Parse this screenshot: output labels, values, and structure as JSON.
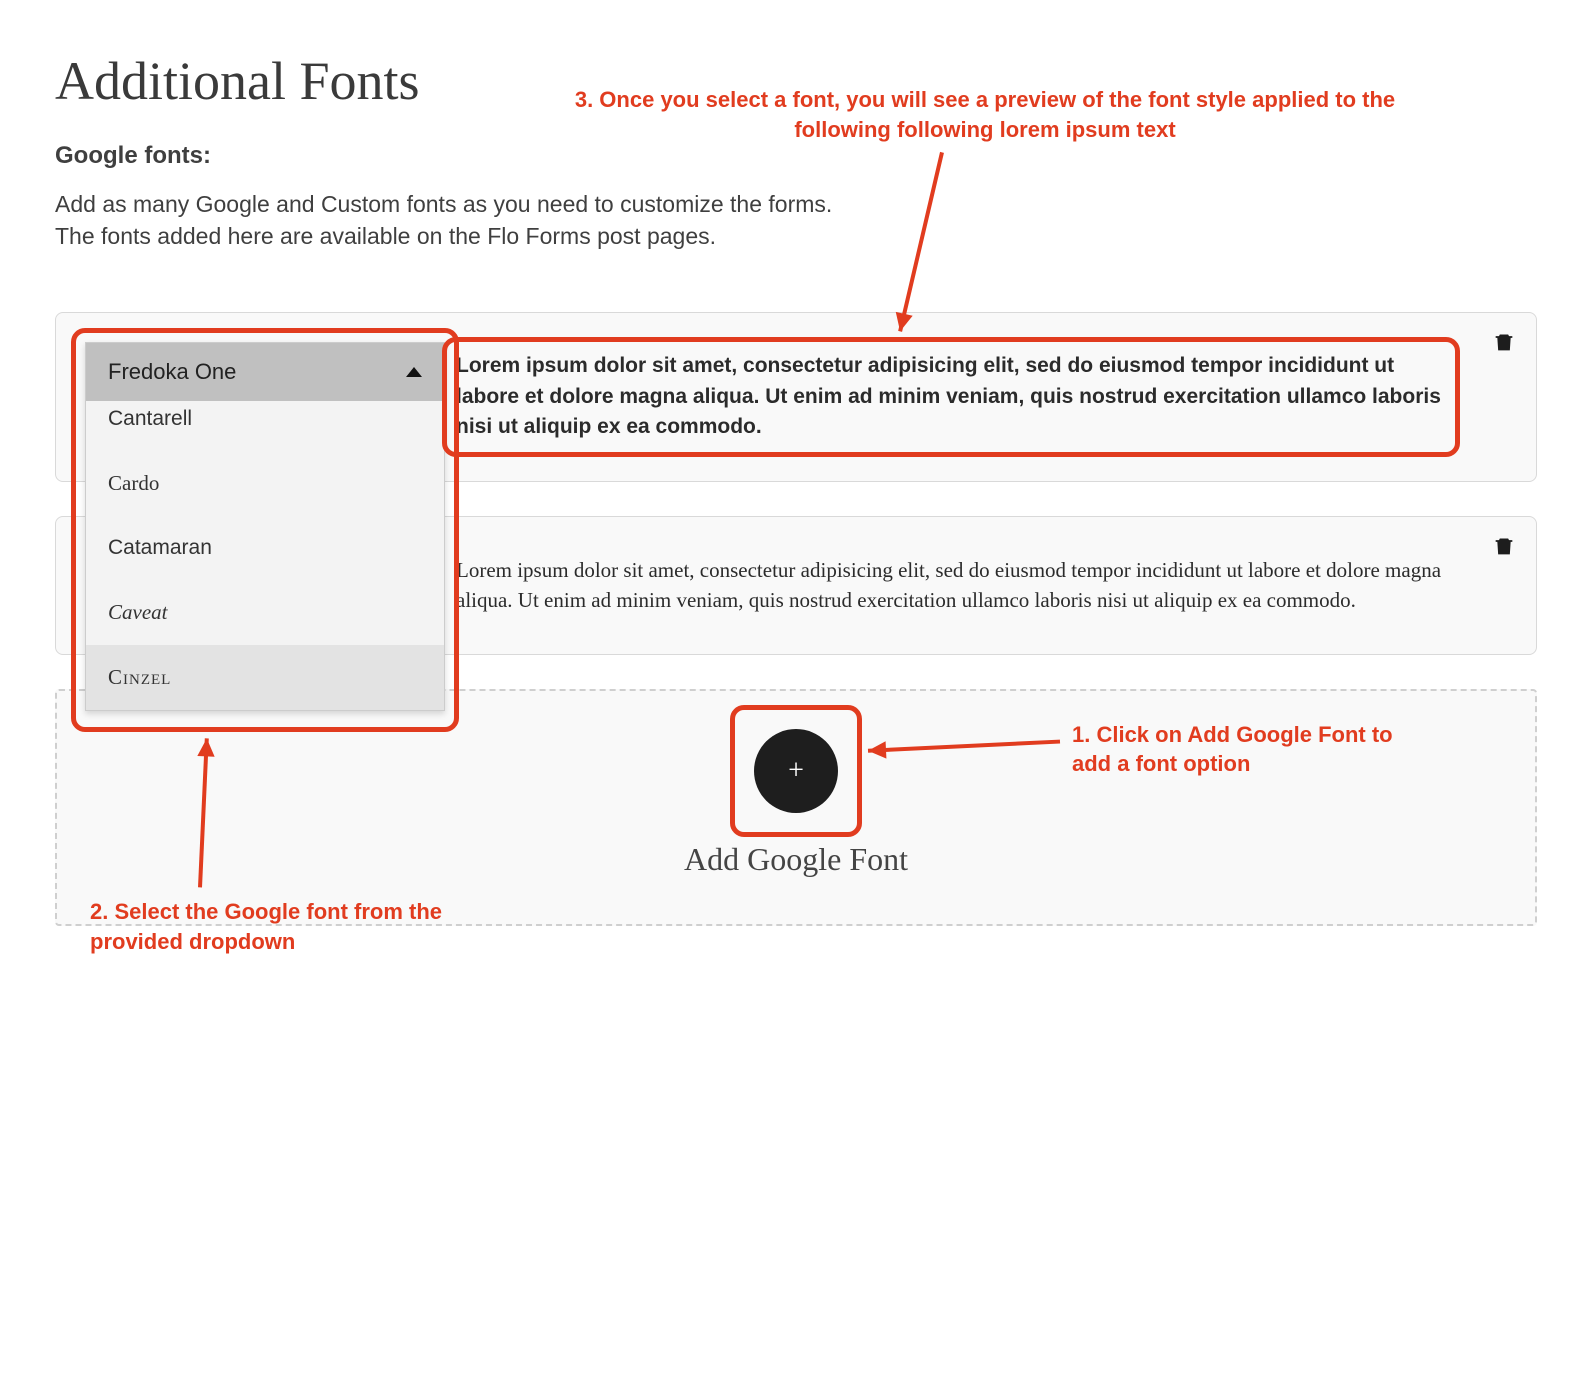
{
  "page_title": "Additional Fonts",
  "section_label": "Google fonts:",
  "section_desc_line1": "Add as many Google and Custom fonts as you need to customize the forms.",
  "section_desc_line2": "The fonts added here are available on the Flo Forms post pages.",
  "preview_text": "Lorem ipsum dolor sit amet, consectetur adipisicing elit, sed do eiusmod tempor incididunt ut labore et dolore magna aliqua. Ut enim ad minim veniam, quis nostrud exercitation ullamco laboris nisi ut aliquip ex ea commodo.",
  "dropdown": {
    "selected": "Fredoka One",
    "items": [
      "Cantarell",
      "Cardo",
      "Catamaran",
      "Caveat",
      "Cinzel"
    ]
  },
  "add_font_label": "Add Google Font",
  "annotations": {
    "step1": "1. Click on Add Google Font to add a font option",
    "step2": "2. Select the Google font from the provided dropdown",
    "step3": "3. Once you select a font, you will see a preview of the font style applied to the following following lorem ipsum text"
  }
}
